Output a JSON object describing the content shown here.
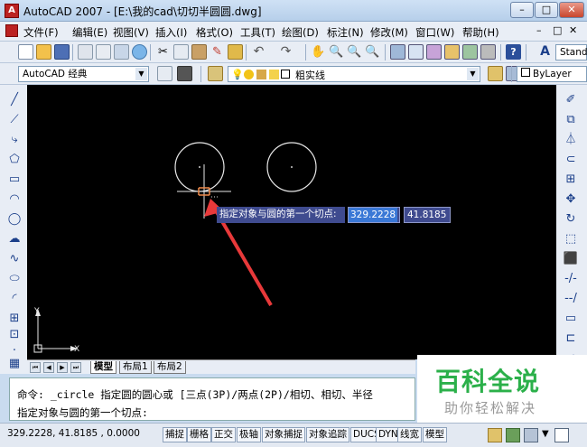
{
  "window": {
    "title": "AutoCAD 2007 - [E:\\我的cad\\切切半圆圆.dwg]",
    "controls": {
      "minimize": "–",
      "maximize": "□",
      "close": "✕"
    }
  },
  "menu": {
    "items": [
      "文件(F)",
      "编辑(E)",
      "视图(V)",
      "插入(I)",
      "格式(O)",
      "工具(T)",
      "绘图(D)",
      "标注(N)",
      "修改(M)",
      "窗口(W)",
      "帮助(H)"
    ],
    "doc_controls": [
      "–",
      "□",
      "✕"
    ]
  },
  "toolbar": {
    "style_dropdown": "Stand",
    "workspace_dropdown": "AutoCAD 经典",
    "layer_dropdown": "粗实线",
    "color_dropdown": "ByLayer"
  },
  "canvas": {
    "ucs": {
      "x_label": "X",
      "y_label": "Y"
    },
    "tooltip": {
      "prompt": "指定对象与圆的第一个切点:",
      "x_value": "329.2228",
      "y_value": "41.8185"
    }
  },
  "tabs": {
    "nav": [
      "⏮",
      "◀",
      "▶",
      "⏭"
    ],
    "items": [
      "模型",
      "布局1",
      "布局2"
    ],
    "active": "模型"
  },
  "command": {
    "line1": "命令: _circle 指定圆的圆心或 [三点(3P)/两点(2P)/相切、相切、半径",
    "line2": "指定对象与圆的第一个切点:"
  },
  "status": {
    "coords": "329.2228, 41.8185 , 0.0000",
    "toggles": [
      "捕捉",
      "栅格",
      "正交",
      "极轴",
      "对象捕捉",
      "对象追踪",
      "DUCS",
      "DYN",
      "线宽",
      "模型"
    ]
  },
  "watermark": {
    "brand": "百科全说",
    "slogan": "助你轻松解决"
  },
  "colors": {
    "canvas": "#000000",
    "accent_arrow": "#e8393a",
    "tooltip_bg": "#3f4b8f",
    "selected_value_bg": "#3a78d6"
  }
}
